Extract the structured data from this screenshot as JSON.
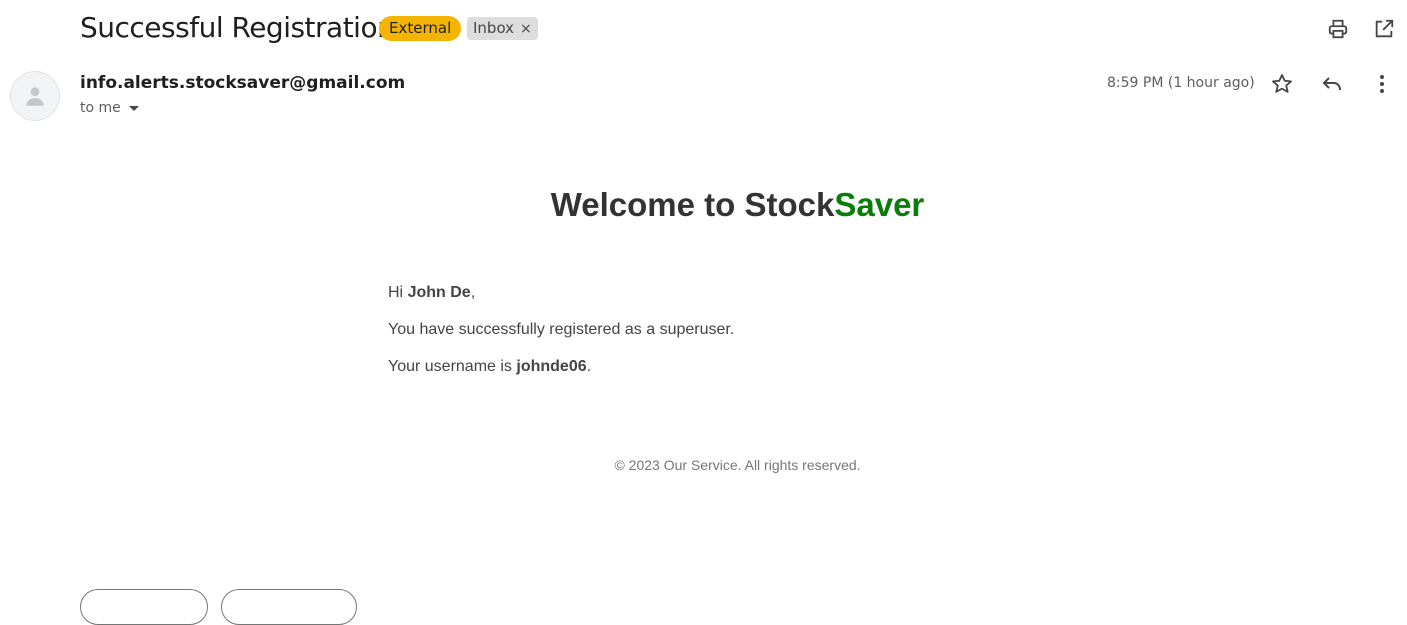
{
  "email": {
    "subject": "Successful Registration",
    "labels": {
      "external": "External",
      "inbox": "Inbox",
      "inbox_remove": "×"
    },
    "sender": "info.alerts.stocksaver@gmail.com",
    "recipient": "to me",
    "timestamp": "8:59 PM (1 hour ago)"
  },
  "message": {
    "heading_prefix": "Welcome to Stock",
    "heading_accent": "Saver",
    "greeting_prefix": "Hi ",
    "user_name": "John De",
    "greeting_suffix": ",",
    "line1": "You have successfully registered as a superuser.",
    "username_prefix": "Your username is ",
    "username": "johnde06",
    "username_suffix": ".",
    "footer": "© 2023 Our Service. All rights reserved."
  },
  "colors": {
    "external_badge": "#f4b400",
    "inbox_badge": "#dddddd",
    "accent_green": "#0a7c0a"
  },
  "icons": {
    "print": "print-icon",
    "open_new_window": "open-in-new-window-icon",
    "star": "star-icon",
    "reply": "reply-icon",
    "more": "more-vertical-icon",
    "avatar": "person-icon"
  }
}
